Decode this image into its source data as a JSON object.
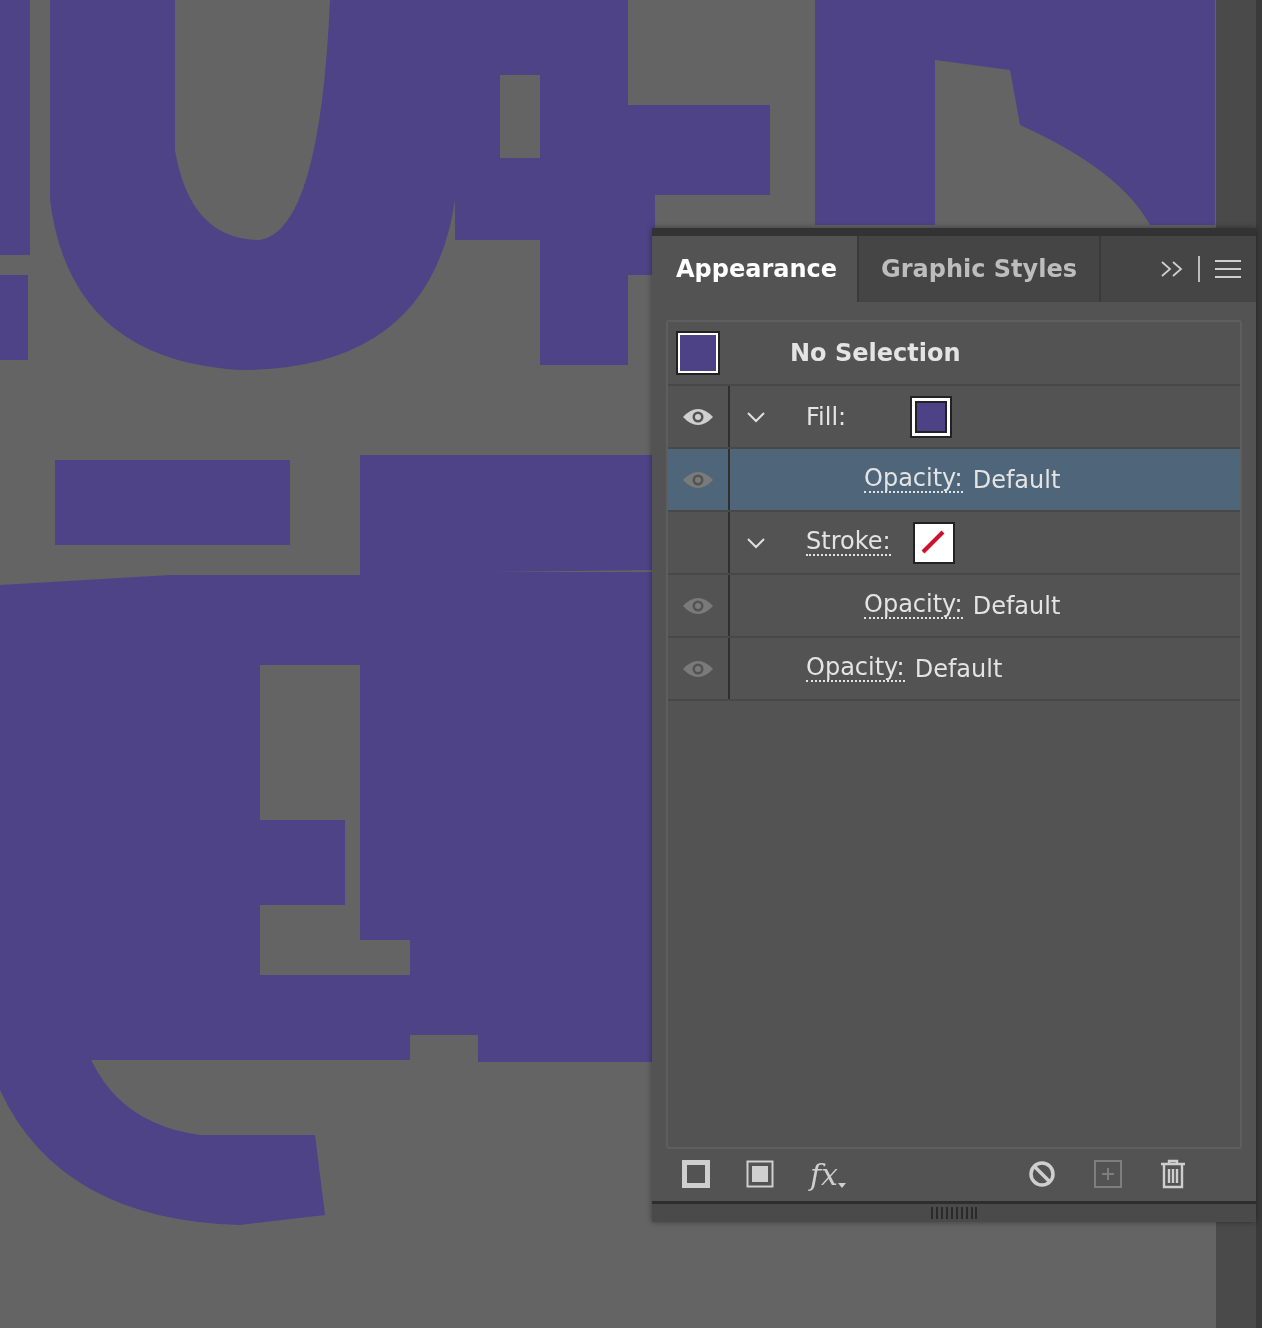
{
  "tabs": [
    {
      "label": "Appearance",
      "selected": true
    },
    {
      "label": "Graphic Styles",
      "selected": false
    }
  ],
  "header": {
    "label": "No Selection",
    "color": "#4e4287"
  },
  "rows": [
    {
      "kind": "fill",
      "label": "Fill:",
      "linked": false,
      "eye_shown": true,
      "eye_dim": false,
      "expanded": true,
      "selected": false,
      "swatch": {
        "kind": "color",
        "color": "#4e4287"
      },
      "children": [
        {
          "kind": "opacity",
          "label": "Opacity:",
          "value": "Default",
          "linked": true,
          "eye_shown": true,
          "eye_dim": true,
          "selected": true
        }
      ]
    },
    {
      "kind": "stroke",
      "label": "Stroke:",
      "linked": true,
      "eye_shown": false,
      "expanded": true,
      "selected": false,
      "swatch": {
        "kind": "none"
      },
      "children": [
        {
          "kind": "opacity",
          "label": "Opacity:",
          "value": "Default",
          "linked": true,
          "eye_shown": true,
          "eye_dim": true,
          "selected": false
        }
      ]
    },
    {
      "kind": "opacity",
      "label": "Opacity:",
      "value": "Default",
      "linked": true,
      "eye_shown": true,
      "eye_dim": true,
      "selected": false
    }
  ],
  "footer": [
    {
      "kind": "stroke",
      "disabled": false
    },
    {
      "kind": "fill",
      "disabled": false
    },
    {
      "kind": "fx",
      "label": "fx",
      "disabled": false
    },
    {
      "kind": "clear",
      "disabled": false
    },
    {
      "kind": "add",
      "disabled": true
    },
    {
      "kind": "delete",
      "disabled": false
    }
  ]
}
